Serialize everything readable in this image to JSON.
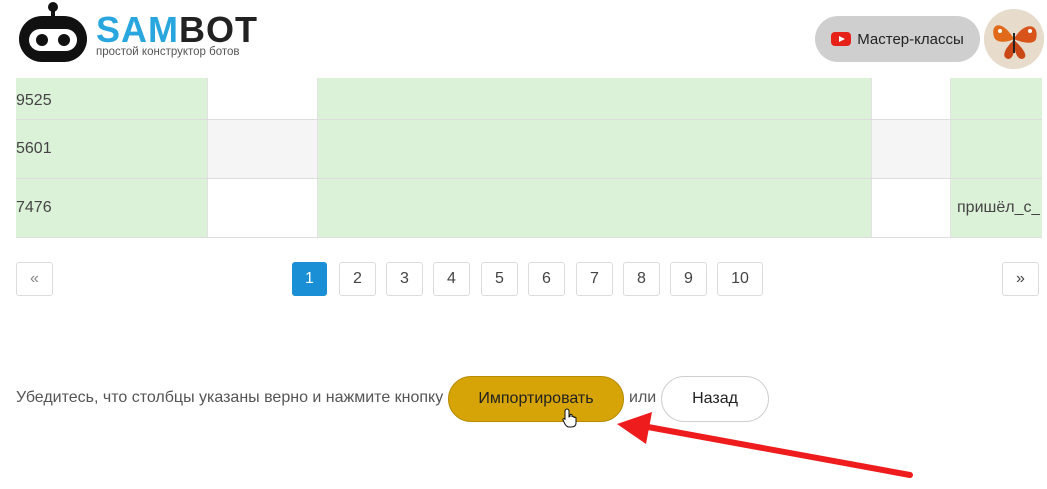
{
  "header": {
    "brand_sam": "SAM",
    "brand_bot": "BOT",
    "tagline": "простой конструктор ботов",
    "master_label": "Мастер-классы"
  },
  "table": {
    "rows": [
      {
        "c1": "9525",
        "c5": ""
      },
      {
        "c1": "5601",
        "c5": ""
      },
      {
        "c1": "7476",
        "c5": "пришёл_с_"
      }
    ]
  },
  "pagination": {
    "prev": "«",
    "next": "»",
    "pages": [
      "1",
      "2",
      "3",
      "4",
      "5",
      "6",
      "7",
      "8",
      "9",
      "10"
    ],
    "active_page": "1"
  },
  "footer": {
    "instruction": "Убедитесь, что столбцы указаны верно и нажмите кнопку",
    "import_label": "Импортировать",
    "or_label": "или",
    "back_label": "Назад"
  },
  "colors": {
    "brand_blue": "#2aa6df",
    "import_yellow": "#d6a407",
    "active_page": "#1a8fd6",
    "row_green": "#dcf2d8",
    "annotation_arrow": "#ee1c1c"
  },
  "icons": {
    "logo": "robot-icon",
    "youtube": "youtube-icon",
    "cursor": "hand-pointer-icon",
    "annotation": "red-arrow-icon"
  }
}
